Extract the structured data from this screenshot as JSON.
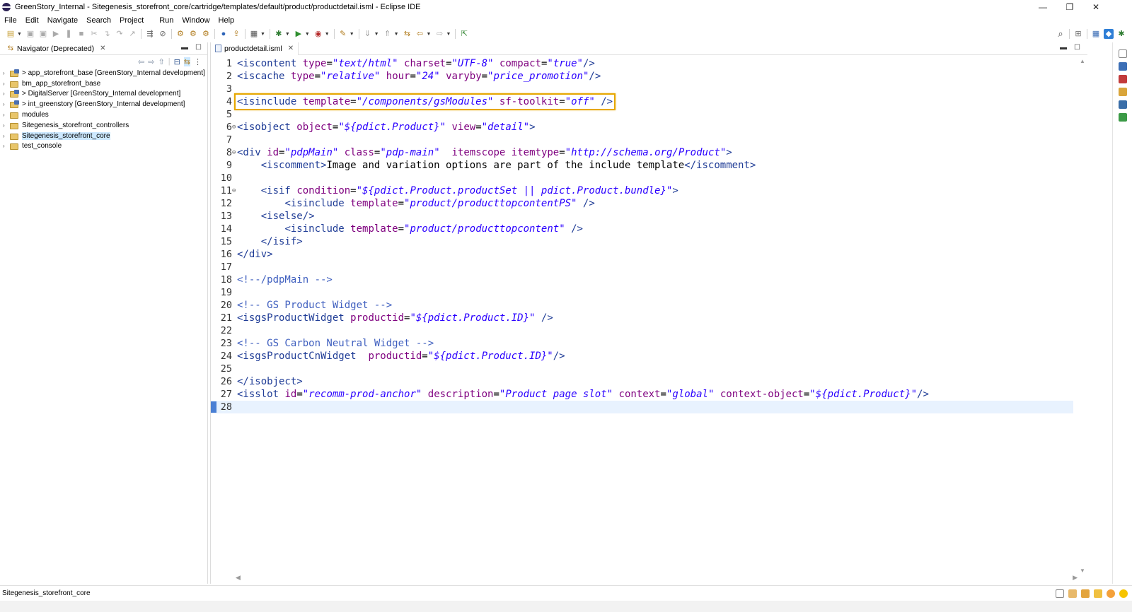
{
  "window": {
    "title": "GreenStory_Internal - Sitegenesis_storefront_core/cartridge/templates/default/product/productdetail.isml - Eclipse IDE",
    "minimize": "—",
    "restore": "❐",
    "close": "✕"
  },
  "menu": [
    {
      "label": "File"
    },
    {
      "label": "Edit"
    },
    {
      "label": "Navigate"
    },
    {
      "label": "Search"
    },
    {
      "label": "Project"
    },
    {
      "label": "Run"
    },
    {
      "label": "Window"
    },
    {
      "label": "Help"
    }
  ],
  "navigator": {
    "tab_label": "Navigator (Deprecated)",
    "tab_close": "✕",
    "items": [
      {
        "label": "> app_storefront_base [GreenStory_Internal development]",
        "selected": false
      },
      {
        "label": "bm_app_storefront_base",
        "selected": false
      },
      {
        "label": "> DigitalServer [GreenStory_Internal development]",
        "selected": false
      },
      {
        "label": "> int_greenstory [GreenStory_Internal development]",
        "selected": false
      },
      {
        "label": "modules",
        "selected": false
      },
      {
        "label": "Sitegenesis_storefront_controllers",
        "selected": false
      },
      {
        "label": "Sitegenesis_storefront_core",
        "selected": true
      },
      {
        "label": "test_console",
        "selected": false
      }
    ]
  },
  "editor": {
    "tab_label": "productdetail.isml",
    "tab_close": "✕",
    "current_line": 28,
    "highlighted_line": 4,
    "lines": [
      {
        "n": "1",
        "fold": "",
        "text": "<iscontent type=\"text/html\" charset=\"UTF-8\" compact=\"true\"/>"
      },
      {
        "n": "2",
        "fold": "",
        "text": "<iscache type=\"relative\" hour=\"24\" varyby=\"price_promotion\"/>"
      },
      {
        "n": "3",
        "fold": "",
        "text": ""
      },
      {
        "n": "4",
        "fold": "",
        "text": "<isinclude template=\"/components/gsModules\" sf-toolkit=\"off\" />"
      },
      {
        "n": "5",
        "fold": "",
        "text": ""
      },
      {
        "n": "6",
        "fold": "⊖",
        "text": "<isobject object=\"${pdict.Product}\" view=\"detail\">"
      },
      {
        "n": "7",
        "fold": "",
        "text": ""
      },
      {
        "n": "8",
        "fold": "⊖",
        "text": "<div id=\"pdpMain\" class=\"pdp-main\"  itemscope itemtype=\"http://schema.org/Product\">"
      },
      {
        "n": "9",
        "fold": "",
        "text": "    <iscomment>Image and variation options are part of the include template</iscomment>"
      },
      {
        "n": "10",
        "fold": "",
        "text": ""
      },
      {
        "n": "11",
        "fold": "⊖",
        "text": "    <isif condition=\"${pdict.Product.productSet || pdict.Product.bundle}\">"
      },
      {
        "n": "12",
        "fold": "",
        "text": "        <isinclude template=\"product/producttopcontentPS\" />"
      },
      {
        "n": "13",
        "fold": "",
        "text": "    <iselse/>"
      },
      {
        "n": "14",
        "fold": "",
        "text": "        <isinclude template=\"product/producttopcontent\" />"
      },
      {
        "n": "15",
        "fold": "",
        "text": "    </isif>"
      },
      {
        "n": "16",
        "fold": "",
        "text": "</div>"
      },
      {
        "n": "17",
        "fold": "",
        "text": ""
      },
      {
        "n": "18",
        "fold": "",
        "text": "<!--/pdpMain -->"
      },
      {
        "n": "19",
        "fold": "",
        "text": ""
      },
      {
        "n": "20",
        "fold": "",
        "text": "<!-- GS Product Widget -->"
      },
      {
        "n": "21",
        "fold": "",
        "text": "<isgsProductWidget productid=\"${pdict.Product.ID}\" />"
      },
      {
        "n": "22",
        "fold": "",
        "text": ""
      },
      {
        "n": "23",
        "fold": "",
        "text": "<!-- GS Carbon Neutral Widget -->"
      },
      {
        "n": "24",
        "fold": "",
        "text": "<isgsProductCnWidget  productid=\"${pdict.Product.ID}\"/>"
      },
      {
        "n": "25",
        "fold": "",
        "text": ""
      },
      {
        "n": "26",
        "fold": "",
        "text": "</isobject>"
      },
      {
        "n": "27",
        "fold": "",
        "text": "<isslot id=\"recomm-prod-anchor\" description=\"Product page slot\" context=\"global\" context-object=\"${pdict.Product}\"/>"
      },
      {
        "n": "28",
        "fold": "",
        "text": ""
      }
    ]
  },
  "status": {
    "selection": "Sitegenesis_storefront_core"
  },
  "colors": {
    "tag": "#1f3c96",
    "attribute": "#7f007f",
    "value": "#2a00ff",
    "comment": "#3f5fbf",
    "highlight_box": "#e6a700",
    "selection": "#cce8ff",
    "current_line": "#e8f2fe"
  },
  "icons": {
    "window": "eclipse-icon",
    "toolbar": [
      "new-icon",
      "save-icon",
      "save-all-icon",
      "run-icon",
      "debug-icon",
      "search-icon",
      "perspective-icon"
    ]
  }
}
